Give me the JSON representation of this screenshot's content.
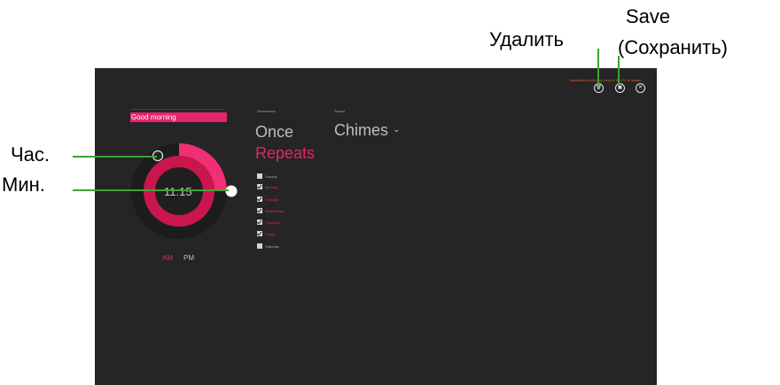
{
  "callouts": {
    "delete": "Удалить",
    "save_line1": "Save",
    "save_line2": "(Сохранить)",
    "hour": "Час.",
    "minute": "Мин."
  },
  "alarm": {
    "name": "Good morning",
    "time": "11:15",
    "am": "AM",
    "pm": "PM",
    "selected_period": "AM"
  },
  "occurrence": {
    "label": "Occurrence",
    "once": "Once",
    "repeats": "Repeats",
    "selected": "Repeats"
  },
  "sound": {
    "label": "Sound",
    "value": "Chimes",
    "chevron": "⌄"
  },
  "days": [
    {
      "label": "Sunday",
      "checked": false
    },
    {
      "label": "Monday",
      "checked": true
    },
    {
      "label": "Tuesday",
      "checked": true
    },
    {
      "label": "Wednesday",
      "checked": true
    },
    {
      "label": "Thursday",
      "checked": true
    },
    {
      "label": "Friday",
      "checked": true
    },
    {
      "label": "Saturday",
      "checked": false
    }
  ],
  "toolbar": {
    "notice": "Notifications will only show if the PC is awake",
    "delete_icon": "trash-icon",
    "save_icon": "save-icon",
    "close_icon": "close-icon",
    "delete_glyph": "🗑",
    "save_glyph": "▣",
    "close_glyph": "✕"
  },
  "colors": {
    "accent": "#e3246b",
    "screen_bg": "#252525",
    "callout_line": "#3aa535",
    "notice": "#d9622b"
  }
}
